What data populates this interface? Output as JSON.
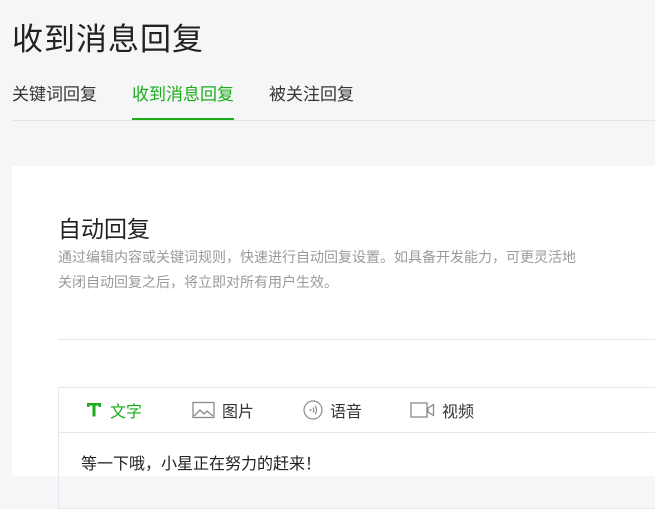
{
  "page": {
    "title": "收到消息回复"
  },
  "tabs": [
    {
      "label": "关键词回复",
      "active": false
    },
    {
      "label": "收到消息回复",
      "active": true
    },
    {
      "label": "被关注回复",
      "active": false
    }
  ],
  "card": {
    "title": "自动回复",
    "description": [
      "通过编辑内容或关键词规则，快速进行自动回复设置。如具备开发能力，可更灵活地",
      "关闭自动回复之后，将立即对所有用户生效。"
    ]
  },
  "editor": {
    "tools": [
      {
        "label": "文字",
        "icon": "text-icon",
        "active": true
      },
      {
        "label": "图片",
        "icon": "image-icon",
        "active": false
      },
      {
        "label": "语音",
        "icon": "voice-icon",
        "active": false
      },
      {
        "label": "视频",
        "icon": "video-icon",
        "active": false
      }
    ],
    "content": "等一下哦，小星正在努力的赶来！"
  },
  "colors": {
    "accent": "#1aad19",
    "background": "#f5f6f7",
    "text": "#353535",
    "muted": "#9a9a9a"
  }
}
